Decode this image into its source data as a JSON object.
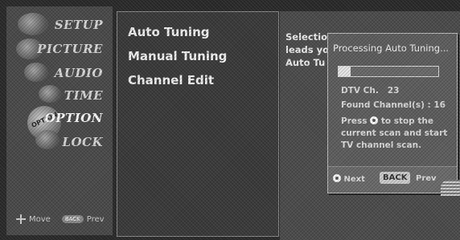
{
  "left_menu": {
    "categories": [
      "SETUP",
      "PICTURE",
      "AUDIO",
      "TIME",
      "OPTION",
      "LOCK"
    ],
    "option_icon_text": "OPTION",
    "move_label": "Move",
    "back_badge": "BACK",
    "prev_label": "Prev"
  },
  "middle_menu": {
    "items": [
      "Auto Tuning",
      "Manual Tuning",
      "Channel Edit"
    ]
  },
  "description": {
    "lines": [
      "Selection",
      "leads yo",
      "Auto Tu"
    ]
  },
  "popup": {
    "title": "Processing Auto Tuning...",
    "progress_fraction": 0.12,
    "dtv_label": "DTV Ch.",
    "dtv_value": "23",
    "found_label": "Found Channel(s) : 16",
    "press_prefix": "Press",
    "press_suffix": "to stop the",
    "instr_line2": "current scan and start",
    "instr_line3": "TV channel  scan.",
    "next_label": "Next",
    "back_button": "BACK",
    "prev_label": "Prev"
  }
}
